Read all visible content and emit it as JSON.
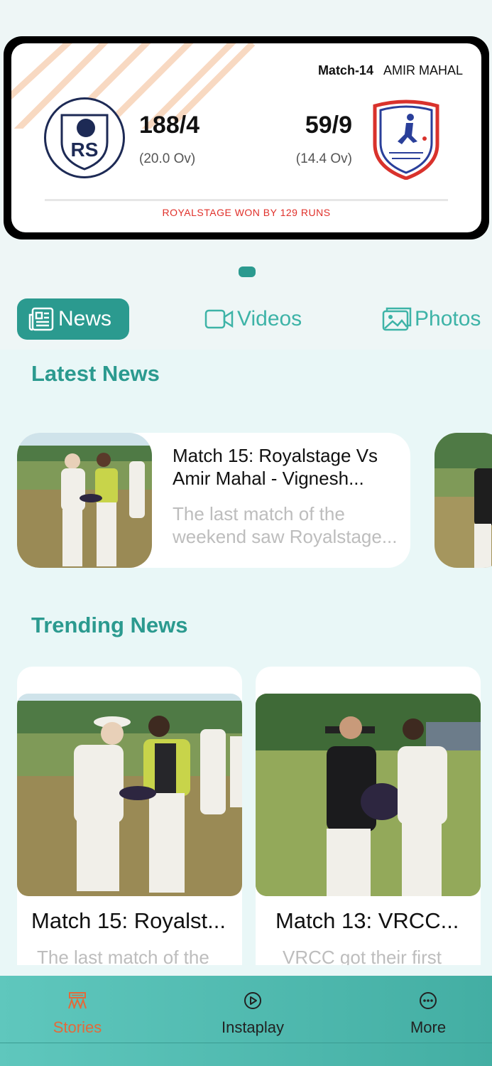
{
  "score_card": {
    "match_no": "Match-14",
    "venue": "AMIR MAHAL",
    "team1": {
      "logo_icon": "rs-logo-icon",
      "score": "188/4",
      "overs": "(20.0 Ov)"
    },
    "team2": {
      "logo_icon": "vraman-memorial-cup-logo-icon",
      "score": "59/9",
      "overs": "(14.4 Ov)"
    },
    "result": "ROYALSTAGE WON BY 129 RUNS"
  },
  "tabs": [
    {
      "label": "News",
      "icon": "news-icon",
      "active": true
    },
    {
      "label": "Videos",
      "icon": "video-camera-icon",
      "active": false
    },
    {
      "label": "Photos",
      "icon": "photos-icon",
      "active": false
    }
  ],
  "latest_news": {
    "title": "Latest News",
    "items": [
      {
        "title": "Match 15: Royalstage Vs Amir Mahal - Vignesh...",
        "desc": "The last match of the weekend saw Royalstage..."
      }
    ]
  },
  "trending_news": {
    "title": "Trending News",
    "items": [
      {
        "title": "Match 15: Royalst...",
        "desc": "The last match of the"
      },
      {
        "title": "Match 13: VRCC...",
        "desc": "VRCC got their first"
      }
    ]
  },
  "bottom_nav": [
    {
      "label": "Stories",
      "icon": "stadium-icon",
      "active": true
    },
    {
      "label": "Instaplay",
      "icon": "play-circle-icon",
      "active": false
    },
    {
      "label": "More",
      "icon": "more-dots-icon",
      "active": false
    }
  ],
  "colors": {
    "accent": "#2b9a8f",
    "result_red": "#e0302a",
    "active_nav": "#e36a3a"
  }
}
